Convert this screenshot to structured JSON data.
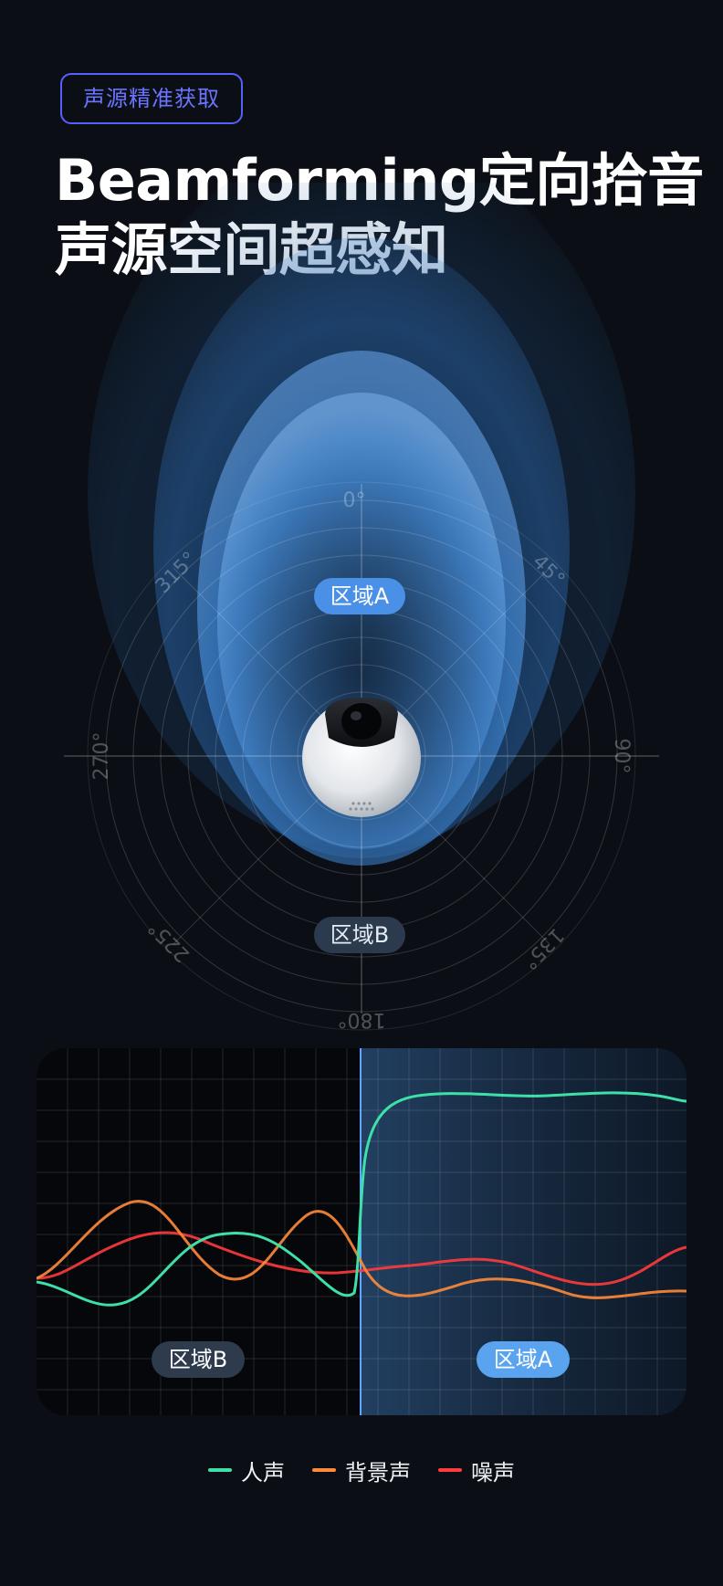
{
  "badge": {
    "label": "声源精准获取"
  },
  "headline": {
    "line1": "Beamforming定向拾音",
    "line2": "声源空间超感知"
  },
  "radar": {
    "angle_labels": [
      "0°",
      "45°",
      "90°",
      "135°",
      "180°",
      "225°",
      "270°",
      "315°"
    ],
    "zone_a_label": "区域A",
    "zone_b_label": "区域B"
  },
  "waveform": {
    "zone_b_label": "区域B",
    "zone_a_label": "区域A"
  },
  "legend": {
    "items": [
      {
        "label": "人声",
        "color": "#3ee0a8"
      },
      {
        "label": "背景声",
        "color": "#ff8a3a"
      },
      {
        "label": "噪声",
        "color": "#ff3b3b"
      }
    ]
  },
  "colors": {
    "accent": "#5660ff",
    "beam": "#4a90e6",
    "background": "#0b0f15"
  }
}
